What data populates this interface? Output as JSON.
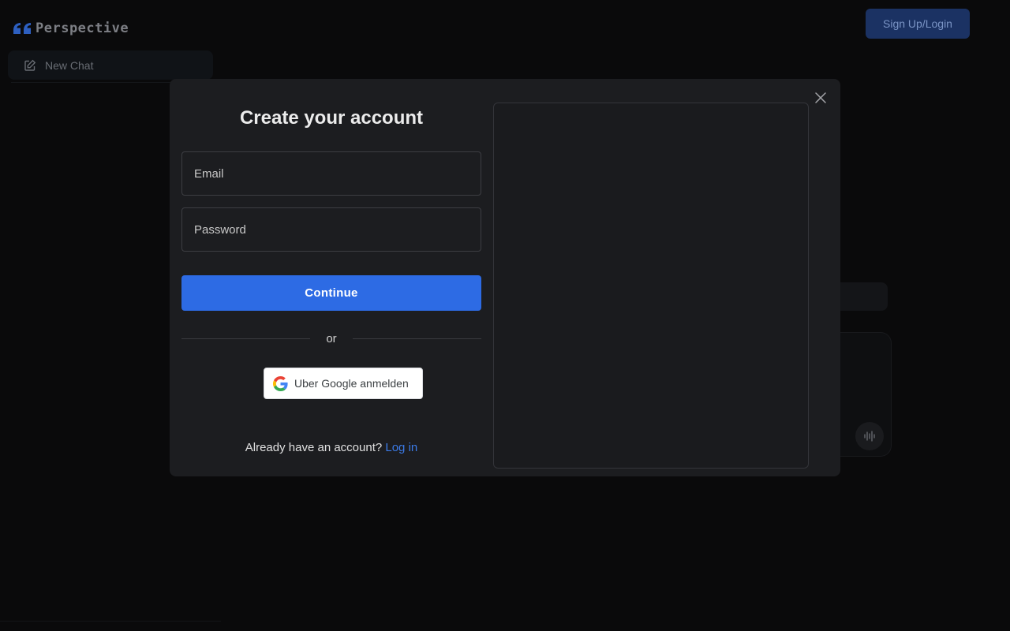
{
  "app": {
    "brand_name": "Perspective",
    "signup_login_label": "Sign Up/Login",
    "new_chat_label": "New Chat"
  },
  "modal": {
    "title": "Create your account",
    "email_placeholder": "Email",
    "password_placeholder": "Password",
    "continue_label": "Continue",
    "or_label": "or",
    "google_label": "Uber Google anmelden",
    "already_text": "Already have an account?",
    "login_link": "Log in"
  },
  "colors": {
    "accent": "#2d6be4",
    "link": "#3b7ae6",
    "logo_blue": "#2d5fc0"
  },
  "icons": {
    "logo": "quote-icon",
    "new_chat": "edit-icon",
    "close": "close-icon",
    "google": "google-logo-icon",
    "voice": "audio-wave-icon"
  }
}
